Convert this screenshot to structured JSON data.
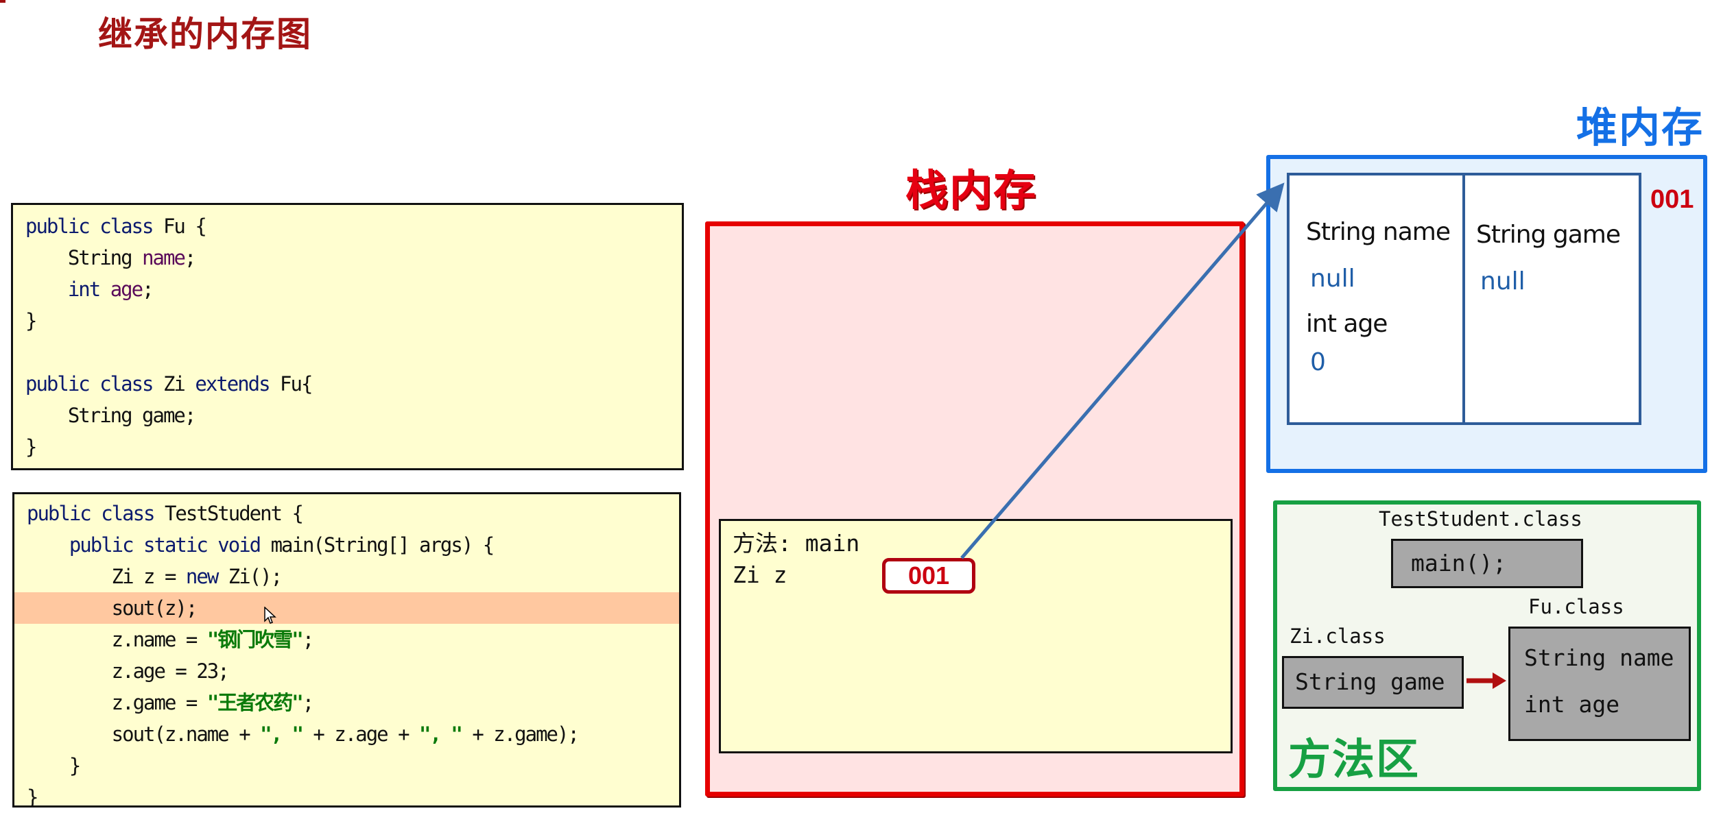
{
  "title": "继承的内存图",
  "code": {
    "block1": [
      [
        {
          "t": "public class",
          "c": "kw"
        },
        {
          "t": " Fu {",
          "c": ""
        }
      ],
      [
        {
          "t": "    String ",
          "c": ""
        },
        {
          "t": "name",
          "c": "fld"
        },
        {
          "t": ";",
          "c": ""
        }
      ],
      [
        {
          "t": "    int",
          "c": "kw"
        },
        {
          "t": " ",
          "c": ""
        },
        {
          "t": "age",
          "c": "fld"
        },
        {
          "t": ";",
          "c": ""
        }
      ],
      [
        {
          "t": "}",
          "c": ""
        }
      ],
      [],
      [
        {
          "t": "public class",
          "c": "kw"
        },
        {
          "t": " Zi ",
          "c": ""
        },
        {
          "t": "extends",
          "c": "kw"
        },
        {
          "t": " Fu{",
          "c": ""
        }
      ],
      [
        {
          "t": "    String game;",
          "c": ""
        }
      ],
      [
        {
          "t": "}",
          "c": ""
        }
      ]
    ],
    "block2": [
      [
        {
          "t": "public class",
          "c": "kw"
        },
        {
          "t": " TestStudent {",
          "c": ""
        }
      ],
      [
        {
          "t": "    public static void",
          "c": "kw"
        },
        {
          "t": " main(String[] args) {",
          "c": ""
        }
      ],
      [
        {
          "t": "        Zi z = ",
          "c": ""
        },
        {
          "t": "new",
          "c": "kw"
        },
        {
          "t": " Zi();",
          "c": ""
        }
      ],
      [
        {
          "t": "        sout(z);",
          "c": ""
        }
      ],
      [
        {
          "t": "        z.name = ",
          "c": ""
        },
        {
          "t": "\"钢门吹雪\"",
          "c": "str"
        },
        {
          "t": ";",
          "c": ""
        }
      ],
      [
        {
          "t": "        z.age = 23;",
          "c": ""
        }
      ],
      [
        {
          "t": "        z.game = ",
          "c": ""
        },
        {
          "t": "\"王者农药\"",
          "c": "str"
        },
        {
          "t": ";",
          "c": ""
        }
      ],
      [
        {
          "t": "        sout(z.name + ",
          "c": ""
        },
        {
          "t": "\", \"",
          "c": "str"
        },
        {
          "t": " + z.age + ",
          "c": ""
        },
        {
          "t": "\", \"",
          "c": "str"
        },
        {
          "t": " + z.game);",
          "c": ""
        }
      ],
      [
        {
          "t": "    }",
          "c": ""
        }
      ],
      [
        {
          "t": "}",
          "c": ""
        }
      ]
    ],
    "highlighted_line_index": 3
  },
  "stack": {
    "title": "栈内存",
    "frame_method": "方法: main",
    "frame_var": "Zi z",
    "address": "001"
  },
  "heap": {
    "title": "堆内存",
    "address": "001",
    "parent_fields": {
      "name_label": "String name",
      "name_value": "null",
      "age_label": "int age",
      "age_value": "0"
    },
    "child_fields": {
      "game_label": "String game",
      "game_value": "null"
    }
  },
  "method_area": {
    "title": "方法区",
    "test_class_label": "TestStudent.class",
    "test_class_method": "main();",
    "zi_class_label": "Zi.class",
    "zi_field": "String game",
    "fu_class_label": "Fu.class",
    "fu_field_1": "String name",
    "fu_field_2": "int age"
  },
  "colors": {
    "stack": "#e60000",
    "heap": "#1470e6",
    "method_area": "#17a043",
    "arrow": "#3a6fb0",
    "inherit_arrow": "#b01010"
  }
}
